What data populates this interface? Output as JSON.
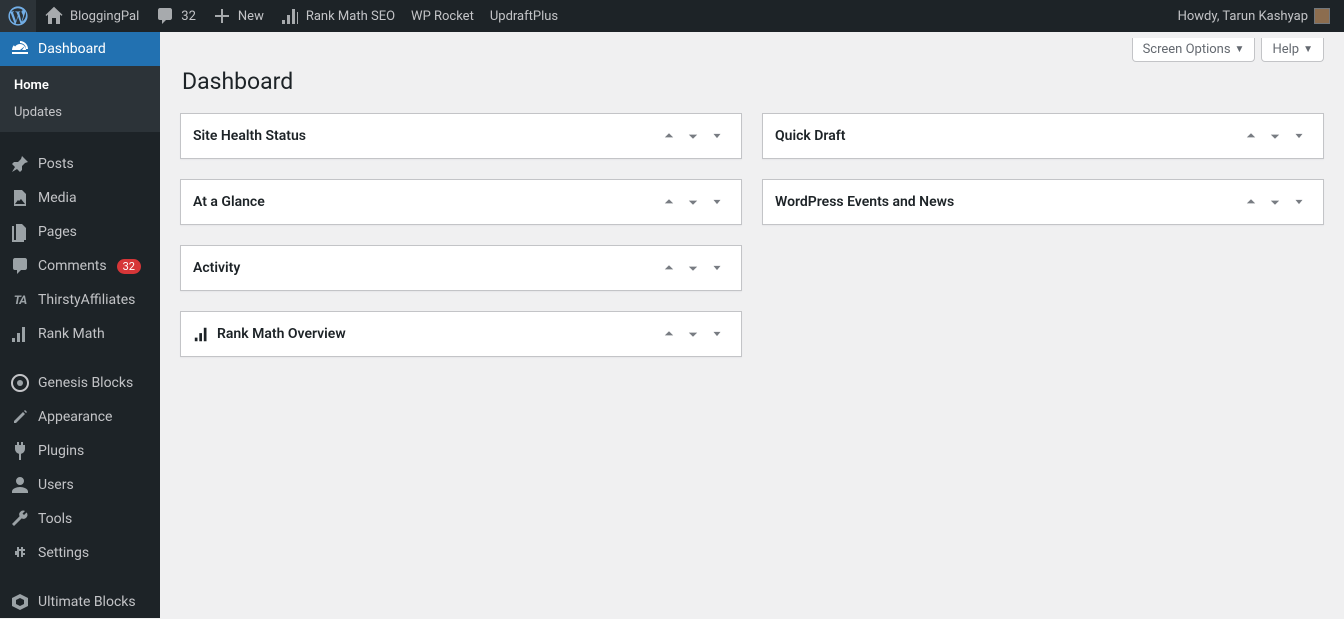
{
  "adminbar": {
    "site_name": "BloggingPal",
    "comments_count": "32",
    "new_label": "New",
    "rank_math_label": "Rank Math SEO",
    "wp_rocket_label": "WP Rocket",
    "updraft_label": "UpdraftPlus",
    "howdy": "Howdy, Tarun Kashyap"
  },
  "sidebar": {
    "dashboard": "Dashboard",
    "home": "Home",
    "updates": "Updates",
    "posts": "Posts",
    "media": "Media",
    "pages": "Pages",
    "comments": "Comments",
    "comments_count": "32",
    "thirsty": "ThirstyAffiliates",
    "rank_math": "Rank Math",
    "genesis_blocks": "Genesis Blocks",
    "appearance": "Appearance",
    "plugins": "Plugins",
    "users": "Users",
    "tools": "Tools",
    "settings": "Settings",
    "ultimate_blocks": "Ultimate Blocks"
  },
  "content": {
    "screen_options": "Screen Options",
    "help": "Help",
    "page_title": "Dashboard",
    "left_widgets": [
      {
        "title": "Site Health Status"
      },
      {
        "title": "At a Glance"
      },
      {
        "title": "Activity"
      },
      {
        "title": "Rank Math Overview",
        "has_logo": true
      }
    ],
    "right_widgets": [
      {
        "title": "Quick Draft"
      },
      {
        "title": "WordPress Events and News"
      }
    ]
  }
}
